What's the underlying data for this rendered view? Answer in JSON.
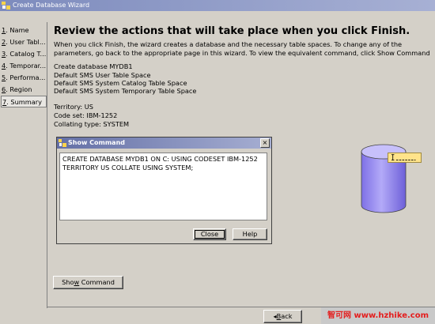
{
  "window": {
    "title": "Create Database Wizard",
    "close_glyph": "×"
  },
  "nav": {
    "items": [
      {
        "num": "1",
        "label": ". Name"
      },
      {
        "num": "2",
        "label": ". User Tabl..."
      },
      {
        "num": "3",
        "label": ". Catalog T..."
      },
      {
        "num": "4",
        "label": ". Temporar..."
      },
      {
        "num": "5",
        "label": ". Performa..."
      },
      {
        "num": "6",
        "label": ". Region"
      },
      {
        "num": "7",
        "label": ". Summary"
      }
    ],
    "active_index": 6
  },
  "summary": {
    "heading": "Review the actions that will take place when you click Finish.",
    "intro": "When you click Finish, the wizard creates a database and the necessary table spaces. To change any of the parameters, go back to the appropriate page in this wizard. To view the equivalent command, click Show Command",
    "actions": [
      "Create database MYDB1",
      "Default SMS User Table Space",
      "Default SMS System Catalog Table Space",
      "Default SMS System Temporary Table Space"
    ],
    "territory": "Territory: US",
    "code_set": "Code set: IBM-1252",
    "collating": "Collating type: SYSTEM"
  },
  "dialog": {
    "title": "Show Command",
    "close_glyph": "×",
    "command": "CREATE DATABASE MYDB1 ON C: USING CODESET IBM-1252 TERRITORY US COLLATE USING SYSTEM;",
    "close_label": "Close",
    "help_label": "Help"
  },
  "buttons": {
    "show_command_pre": "Sho",
    "show_command_u": "w",
    "show_command_post": " Command",
    "back_arrow": "◂",
    "back_u": "B",
    "back_post": "ack"
  },
  "watermark": {
    "text": "智可网 www.hzhike.com"
  },
  "colors": {
    "window_bg": "#d4d0c8",
    "titlebar": "#7d8bbd",
    "database": "#9b8ff0",
    "tooltip": "#ffe38a",
    "watermark_text": "#e41d1d"
  }
}
